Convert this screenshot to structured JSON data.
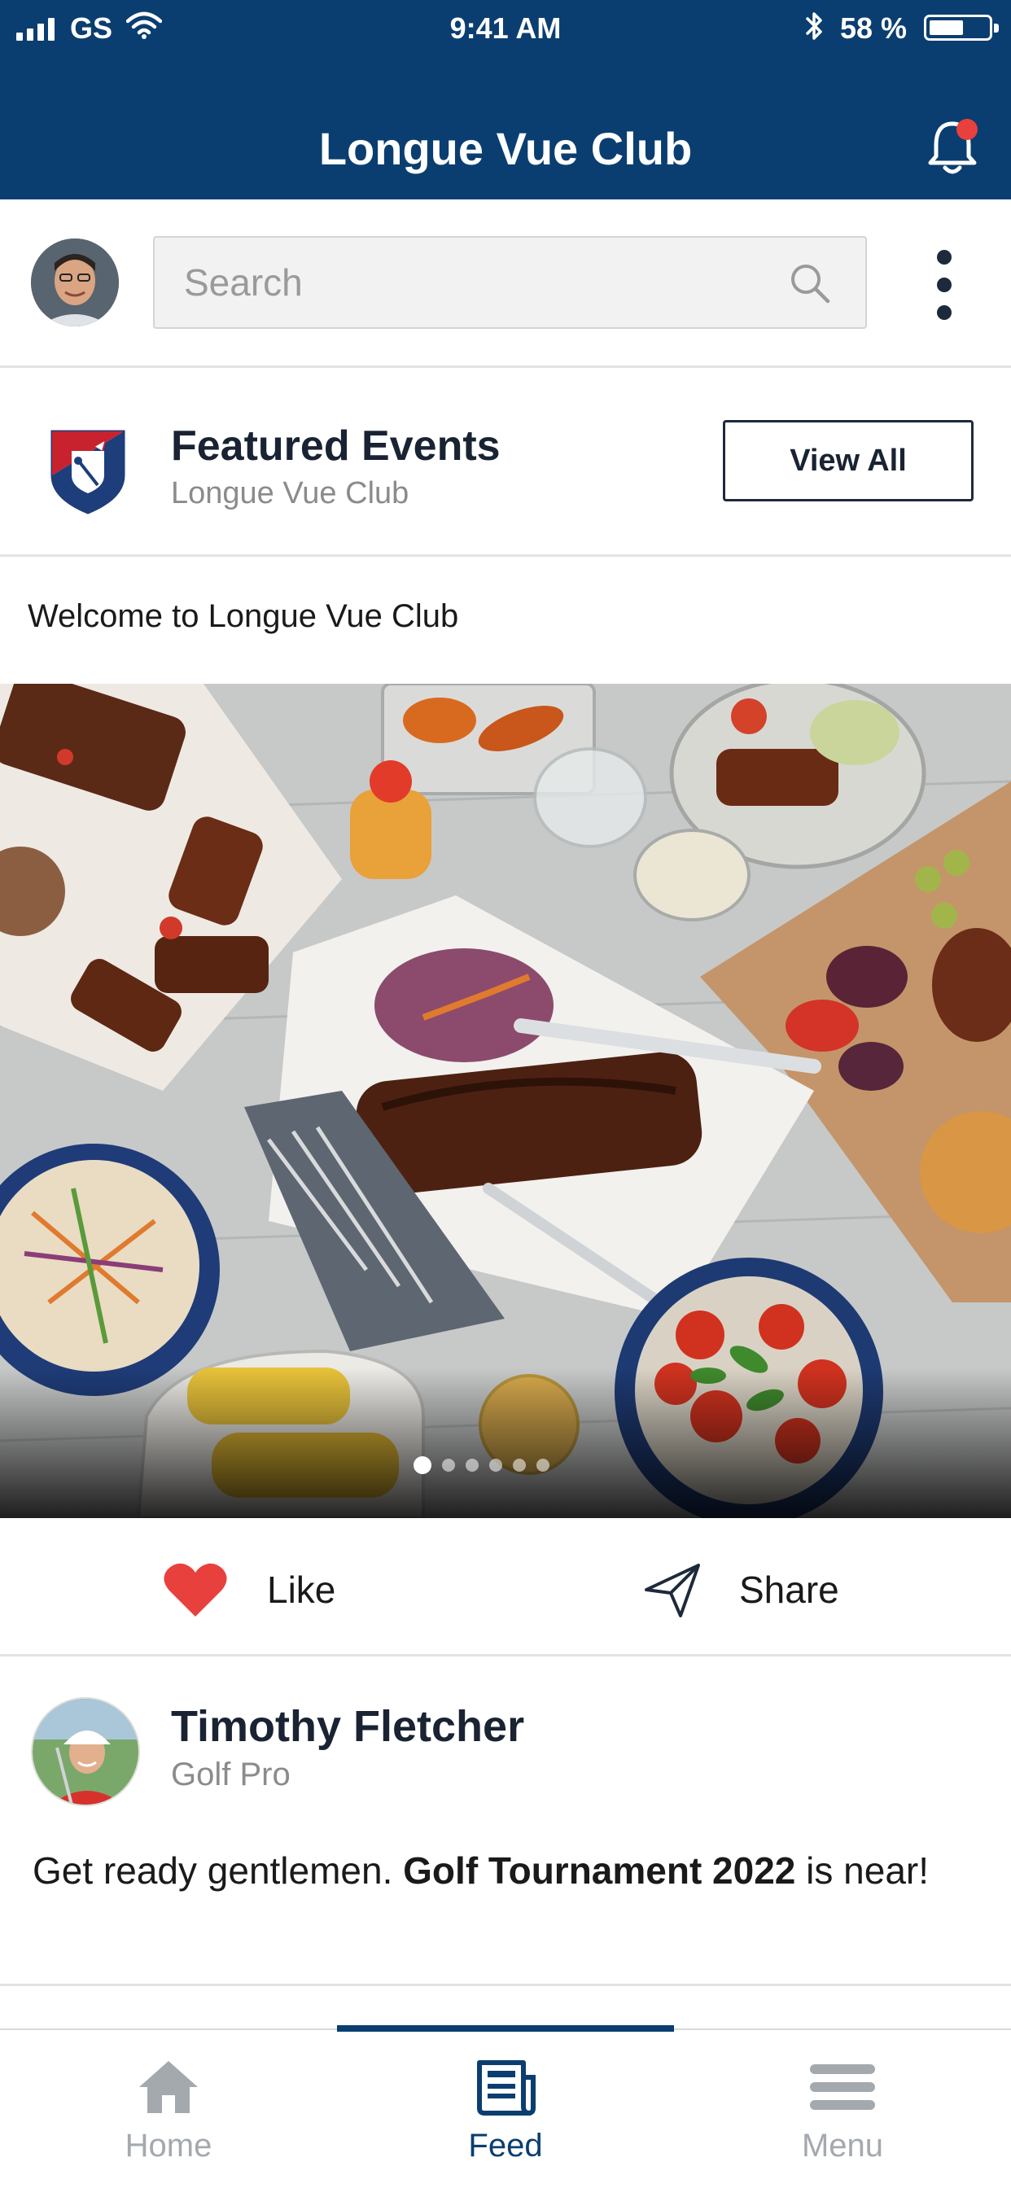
{
  "status_bar": {
    "carrier": "GS",
    "time": "9:41 AM",
    "battery": "58 %",
    "battery_level": 0.58
  },
  "header": {
    "title": "Longue Vue Club",
    "notification_badge": true
  },
  "search": {
    "placeholder": "Search"
  },
  "featured": {
    "title": "Featured Events",
    "subtitle": "Longue Vue Club",
    "view_all_label": "View All"
  },
  "event": {
    "caption": "Welcome to Longue Vue Club",
    "carousel": {
      "count": 6,
      "active_index": 0
    },
    "like_label": "Like",
    "share_label": "Share"
  },
  "post": {
    "author": "Timothy Fletcher",
    "role": "Golf Pro",
    "text_prefix": "Get ready gentlemen. ",
    "text_bold": "Golf Tournament 2022",
    "text_suffix": " is near!"
  },
  "tabs": [
    {
      "label": "Home",
      "icon": "home-icon",
      "active": false
    },
    {
      "label": "Feed",
      "icon": "news-icon",
      "active": true
    },
    {
      "label": "Menu",
      "icon": "menu-icon",
      "active": false
    }
  ],
  "colors": {
    "brand": "#0b3e70",
    "like": "#e8403d",
    "inactive_tab": "#a4a9ae"
  }
}
